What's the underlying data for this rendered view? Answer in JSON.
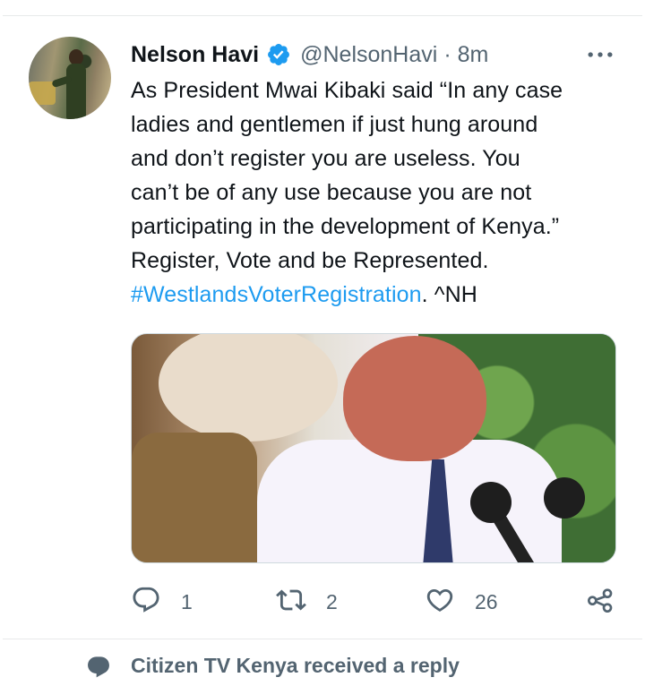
{
  "tweet": {
    "author": {
      "name": "Nelson Havi",
      "handle": "@NelsonHavi",
      "verified": true,
      "avatar_icon": "profile-photo"
    },
    "separator": "·",
    "time": "8m",
    "more_icon": "more-horizontal-icon",
    "text_lines": [
      "As President Mwai Kibaki said “In any case",
      "ladies and gentlemen if just hung around",
      "and don’t register you are useless. You",
      "can’t be of any use because you are not",
      "participating in the development of Kenya.”",
      "Register, Vote and be Represented."
    ],
    "hashtag": "#WestlandsVoterRegistration",
    "suffix": ". ^NH",
    "media": {
      "type": "video-thumbnail"
    },
    "actions": {
      "reply_count": "1",
      "retweet_count": "2",
      "like_count": "26"
    }
  },
  "next_item": {
    "label": "Citizen TV Kenya received a reply"
  },
  "colors": {
    "link": "#1d9bf0",
    "verified": "#1d9bf0",
    "secondary_text": "#536471",
    "divider": "#e7e9ea"
  }
}
